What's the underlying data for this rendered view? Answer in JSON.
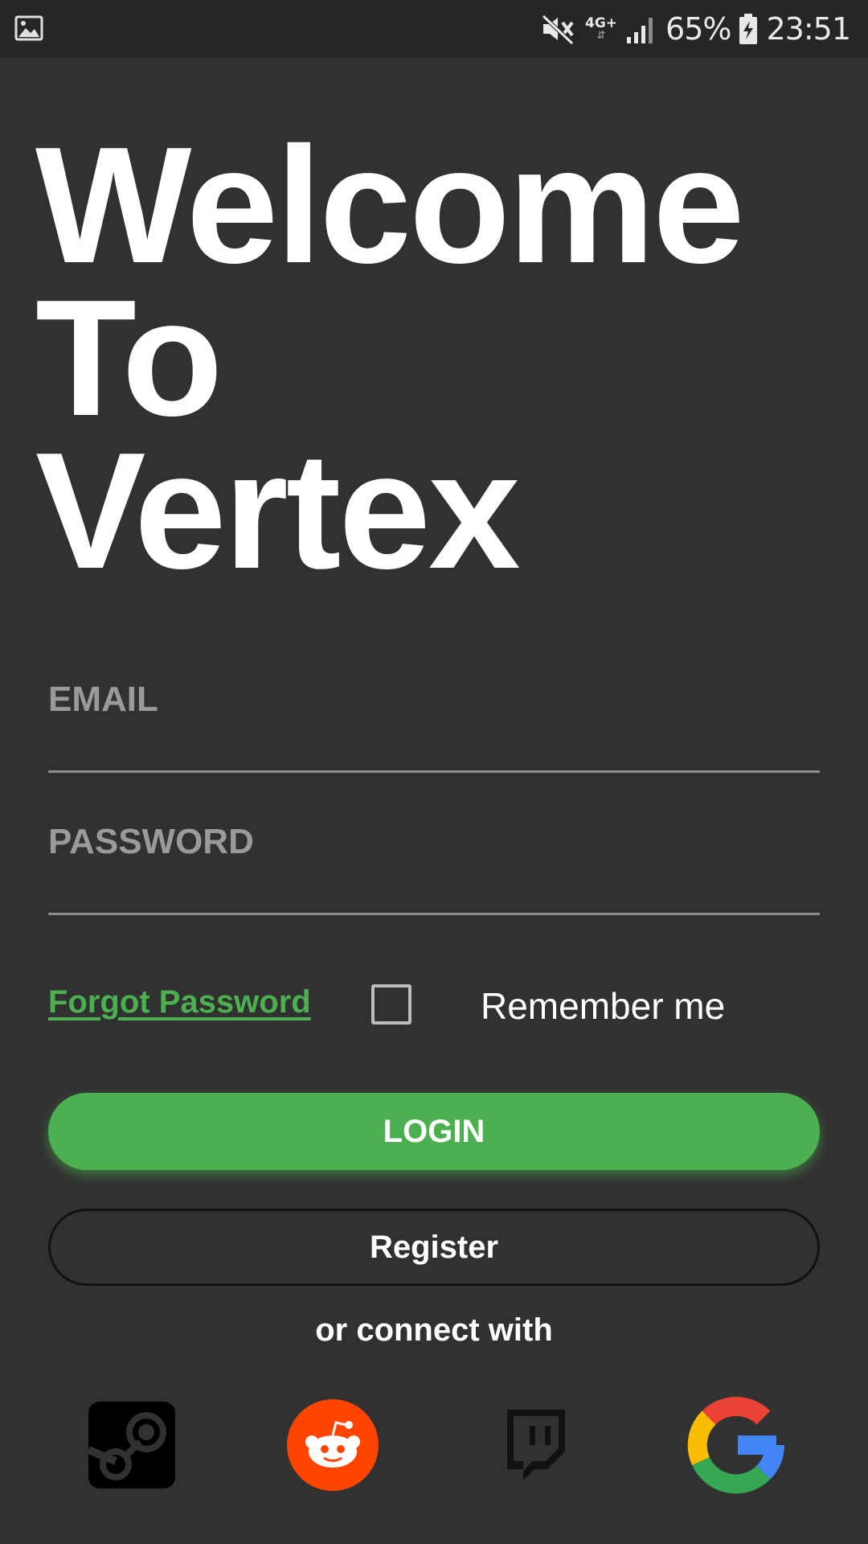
{
  "status_bar": {
    "battery_percent": "65%",
    "time": "23:51",
    "network_type": "4G+",
    "icons": [
      "image-icon",
      "mute-icon",
      "signal-icon",
      "battery-icon"
    ]
  },
  "welcome": {
    "line1": "Welcome",
    "line2": "To",
    "line3": "Vertex"
  },
  "form": {
    "email_placeholder": "EMAIL",
    "password_placeholder": "PASSWORD",
    "forgot_label": "Forgot Password",
    "remember_label": "Remember me",
    "remember_checked": false
  },
  "buttons": {
    "login_label": "LOGIN",
    "register_label": "Register"
  },
  "social": {
    "heading": "or connect with",
    "providers": [
      "steam-icon",
      "reddit-icon",
      "twitch-icon",
      "google-icon"
    ]
  },
  "colors": {
    "background": "#313131",
    "accent": "#4caf50",
    "reddit": "#ff4500",
    "twitch": "#111111"
  }
}
